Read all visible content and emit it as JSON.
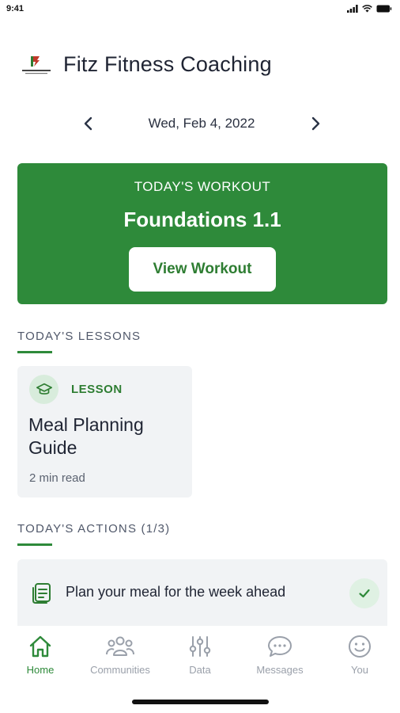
{
  "status_bar": {
    "time": "9:41"
  },
  "header": {
    "title": "Fitz Fitness Coaching",
    "logo_icon": "fitz-fitness-logo"
  },
  "date_nav": {
    "label": "Wed, Feb 4, 2022",
    "prev_icon": "chevron-left-icon",
    "next_icon": "chevron-right-icon"
  },
  "workout": {
    "eyebrow": "TODAY'S WORKOUT",
    "title": "Foundations 1.1",
    "button_label": "View Workout",
    "color": "#2e8a3a"
  },
  "lessons": {
    "header": "TODAY'S LESSONS",
    "cards": [
      {
        "tag": "LESSON",
        "title": "Meal Planning Guide",
        "meta": "2 min read",
        "icon": "graduation-cap-icon"
      }
    ]
  },
  "actions": {
    "header": "TODAY'S ACTIONS (1/3)",
    "items": [
      {
        "label": "Plan your meal for the week ahead",
        "icon": "notes-icon",
        "completed": true
      }
    ]
  },
  "tab_bar": {
    "tabs": [
      {
        "label": "Home",
        "icon": "home-icon",
        "active": true
      },
      {
        "label": "Communities",
        "icon": "people-icon",
        "active": false
      },
      {
        "label": "Data",
        "icon": "sliders-icon",
        "active": false
      },
      {
        "label": "Messages",
        "icon": "chat-bubble-icon",
        "active": false
      },
      {
        "label": "You",
        "icon": "smiley-icon",
        "active": false
      }
    ]
  },
  "colors": {
    "accent": "#2e8a3a",
    "card_bg": "#f1f3f5",
    "inactive_tab": "#9aa0aa"
  }
}
